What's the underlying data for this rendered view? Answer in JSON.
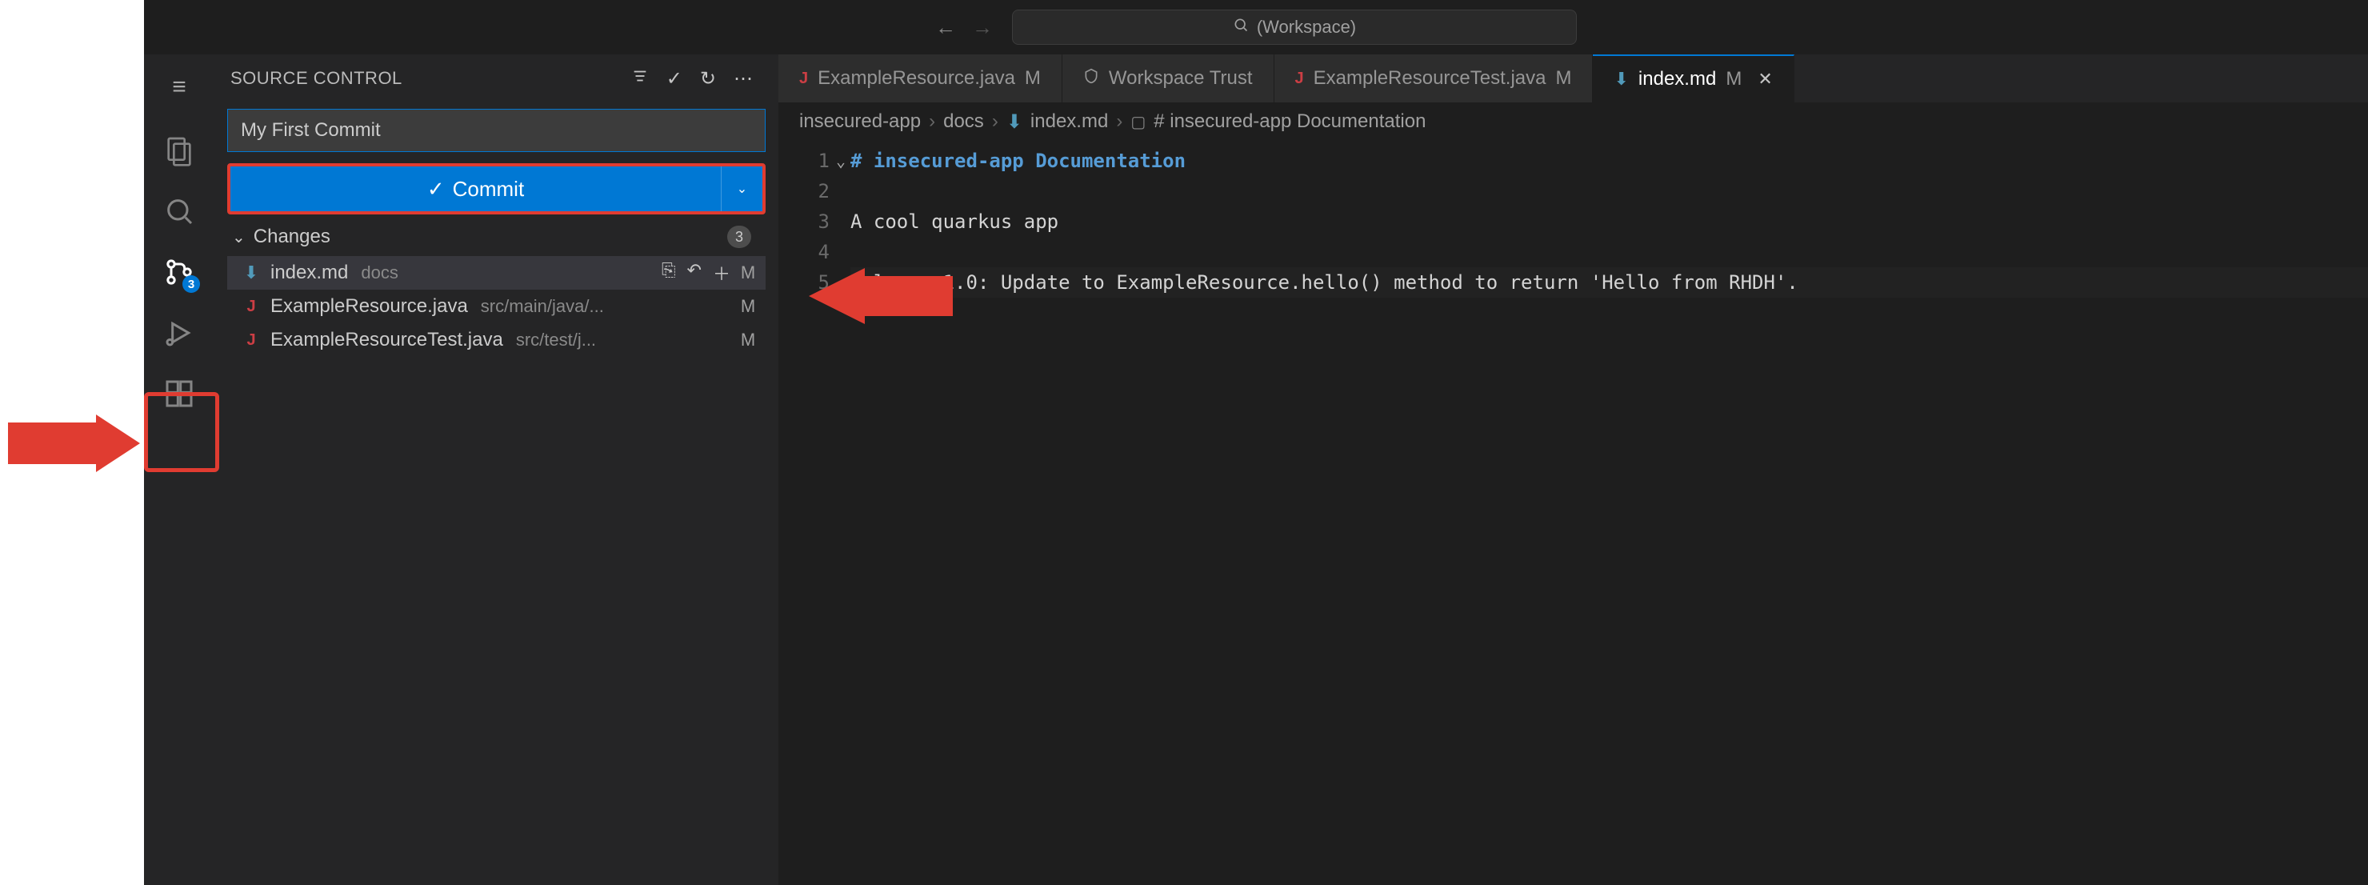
{
  "titlebar": {
    "search_label": "(Workspace)"
  },
  "sidebar": {
    "title": "SOURCE CONTROL",
    "commit_input_value": "My First Commit",
    "commit_button_label": "Commit",
    "changes_label": "Changes",
    "changes_count": "3"
  },
  "scm_badge": "3",
  "changes": [
    {
      "icon": "md",
      "name": "index.md",
      "path": "docs",
      "status": "M",
      "hover": true
    },
    {
      "icon": "java",
      "name": "ExampleResource.java",
      "path": "src/main/java/...",
      "status": "M",
      "hover": false
    },
    {
      "icon": "java",
      "name": "ExampleResourceTest.java",
      "path": "src/test/j...",
      "status": "M",
      "hover": false
    }
  ],
  "tabs": [
    {
      "icon": "java",
      "label": "ExampleResource.java",
      "badge": "M",
      "active": false,
      "closeable": false
    },
    {
      "icon": "shield",
      "label": "Workspace Trust",
      "badge": "",
      "active": false,
      "closeable": false
    },
    {
      "icon": "java",
      "label": "ExampleResourceTest.java",
      "badge": "M",
      "active": false,
      "closeable": false
    },
    {
      "icon": "md",
      "label": "index.md",
      "badge": "M",
      "active": true,
      "closeable": true
    }
  ],
  "breadcrumbs": {
    "parts": [
      "insecured-app",
      "docs",
      "index.md",
      "# insecured-app Documentation"
    ]
  },
  "editor": {
    "lines": [
      {
        "n": "1",
        "text": "# insecured-app Documentation",
        "cls": "tok-comment",
        "fold": true
      },
      {
        "n": "2",
        "text": "",
        "cls": ""
      },
      {
        "n": "3",
        "text": "A cool quarkus app",
        "cls": ""
      },
      {
        "n": "4",
        "text": "",
        "cls": ""
      },
      {
        "n": "5",
        "text": "Release 1.0: Update to ExampleResource.hello() method to return 'Hello from RHDH'.",
        "cls": "",
        "current": true
      }
    ]
  }
}
